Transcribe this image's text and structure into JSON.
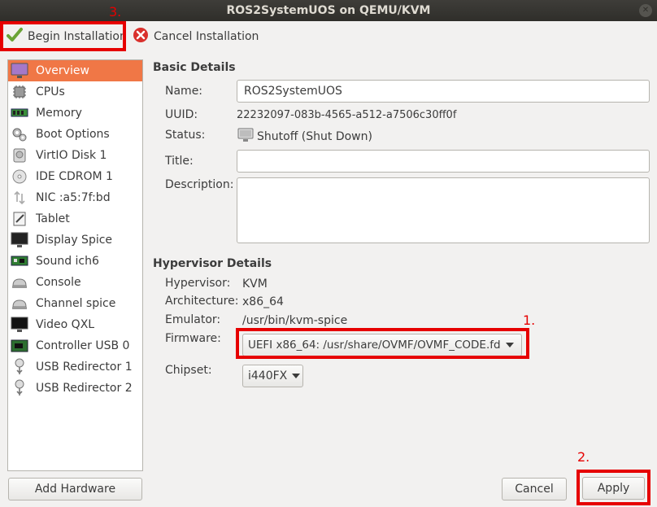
{
  "window": {
    "title": "ROS2SystemUOS on QEMU/KVM"
  },
  "toolbar": {
    "begin_label": "Begin Installation",
    "cancel_label": "Cancel Installation"
  },
  "annotations": {
    "label1": "1.",
    "label2": "2.",
    "label3": "3."
  },
  "sidebar": {
    "items": [
      {
        "label": "Overview",
        "icon": "overview-icon"
      },
      {
        "label": "CPUs",
        "icon": "cpu-icon"
      },
      {
        "label": "Memory",
        "icon": "memory-icon"
      },
      {
        "label": "Boot Options",
        "icon": "gears-icon"
      },
      {
        "label": "VirtIO Disk 1",
        "icon": "disk-icon"
      },
      {
        "label": "IDE CDROM 1",
        "icon": "cdrom-icon"
      },
      {
        "label": "NIC :a5:7f:bd",
        "icon": "network-icon"
      },
      {
        "label": "Tablet",
        "icon": "tablet-icon"
      },
      {
        "label": "Display Spice",
        "icon": "display-icon"
      },
      {
        "label": "Sound ich6",
        "icon": "sound-card-icon"
      },
      {
        "label": "Console",
        "icon": "console-icon"
      },
      {
        "label": "Channel spice",
        "icon": "channel-icon"
      },
      {
        "label": "Video QXL",
        "icon": "video-icon"
      },
      {
        "label": "Controller USB 0",
        "icon": "controller-icon"
      },
      {
        "label": "USB Redirector 1",
        "icon": "usb-icon"
      },
      {
        "label": "USB Redirector 2",
        "icon": "usb-icon"
      }
    ],
    "add_hardware_label": "Add Hardware"
  },
  "basic": {
    "title": "Basic Details",
    "name_label": "Name:",
    "name_value": "ROS2SystemUOS",
    "uuid_label": "UUID:",
    "uuid_value": "22232097-083b-4565-a512-a7506c30ff0f",
    "status_label": "Status:",
    "status_value": "Shutoff (Shut Down)",
    "title_label": "Title:",
    "title_value": "",
    "description_label": "Description:",
    "description_value": ""
  },
  "hypervisor": {
    "title": "Hypervisor Details",
    "hypervisor_label": "Hypervisor:",
    "hypervisor_value": "KVM",
    "architecture_label": "Architecture:",
    "architecture_value": "x86_64",
    "emulator_label": "Emulator:",
    "emulator_value": "/usr/bin/kvm-spice",
    "firmware_label": "Firmware:",
    "firmware_value": "UEFI x86_64: /usr/share/OVMF/OVMF_CODE.fd",
    "chipset_label": "Chipset:",
    "chipset_value": "i440FX"
  },
  "footer": {
    "cancel_label": "Cancel",
    "apply_label": "Apply"
  },
  "colors": {
    "selection": "#f07746",
    "annotation_red": "#e60000",
    "titlebar": "#2f2e2a"
  }
}
